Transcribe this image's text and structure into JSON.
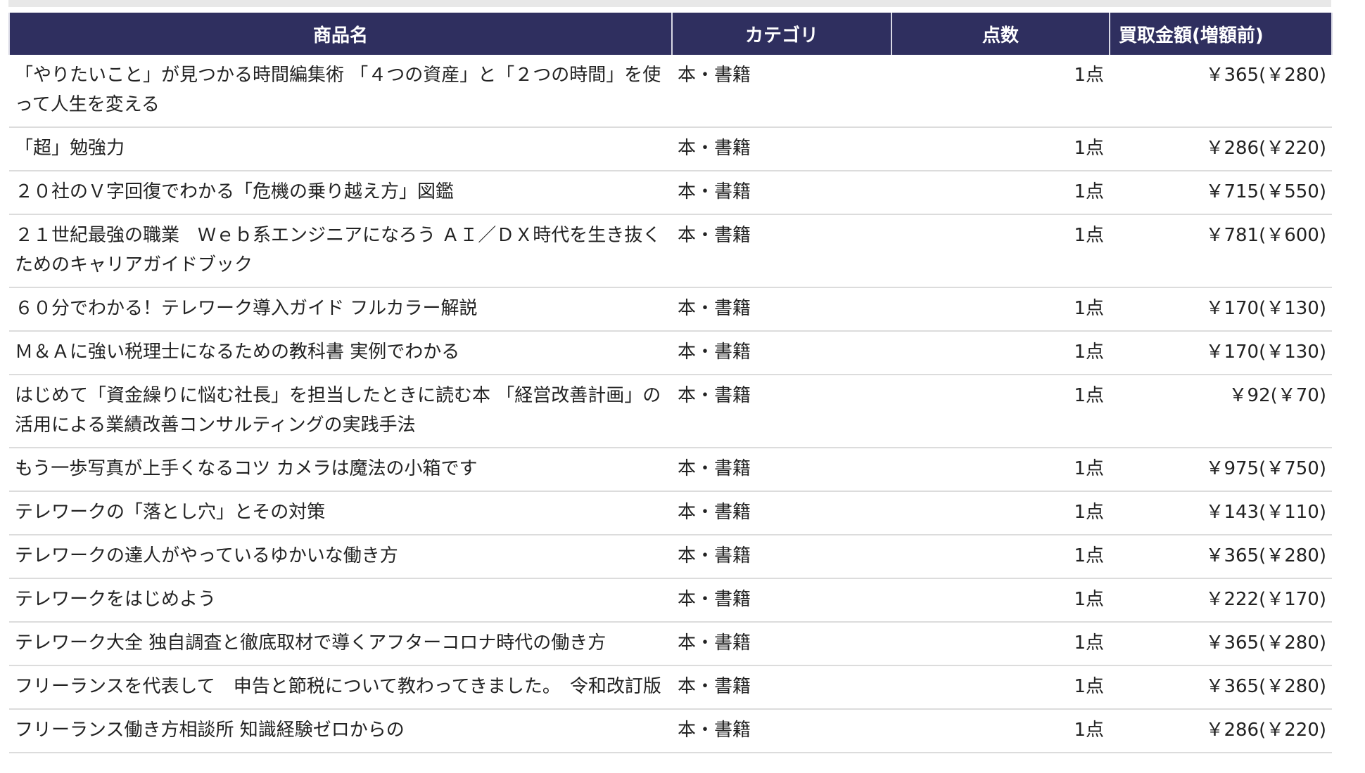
{
  "table": {
    "headers": {
      "name": "商品名",
      "category": "カテゴリ",
      "count": "点数",
      "amount": "買取金額(増額前)"
    },
    "rows": [
      {
        "name": "「やりたいこと」が見つかる時間編集術 「４つの資産」と「２つの時間」を使って人生を変える",
        "category": "本・書籍",
        "count": "1点",
        "amount": "￥365(￥280)"
      },
      {
        "name": "「超」勉強力",
        "category": "本・書籍",
        "count": "1点",
        "amount": "￥286(￥220)"
      },
      {
        "name": "２０社のＶ字回復でわかる「危機の乗り越え方」図鑑",
        "category": "本・書籍",
        "count": "1点",
        "amount": "￥715(￥550)"
      },
      {
        "name": "２１世紀最強の職業　Ｗｅｂ系エンジニアになろう ＡＩ／ＤＸ時代を生き抜くためのキャリアガイドブック",
        "category": "本・書籍",
        "count": "1点",
        "amount": "￥781(￥600)"
      },
      {
        "name": "６０分でわかる！テレワーク導入ガイド フルカラー解説",
        "category": "本・書籍",
        "count": "1点",
        "amount": "￥170(￥130)"
      },
      {
        "name": "Ｍ＆Ａに強い税理士になるための教科書 実例でわかる",
        "category": "本・書籍",
        "count": "1点",
        "amount": "￥170(￥130)"
      },
      {
        "name": "はじめて「資金繰りに悩む社長」を担当したときに読む本 「経営改善計画」の活用による業績改善コンサルティングの実践手法",
        "category": "本・書籍",
        "count": "1点",
        "amount": "￥92(￥70)"
      },
      {
        "name": "もう一歩写真が上手くなるコツ カメラは魔法の小箱です",
        "category": "本・書籍",
        "count": "1点",
        "amount": "￥975(￥750)"
      },
      {
        "name": "テレワークの「落とし穴」とその対策",
        "category": "本・書籍",
        "count": "1点",
        "amount": "￥143(￥110)"
      },
      {
        "name": "テレワークの達人がやっているゆかいな働き方",
        "category": "本・書籍",
        "count": "1点",
        "amount": "￥365(￥280)"
      },
      {
        "name": "テレワークをはじめよう",
        "category": "本・書籍",
        "count": "1点",
        "amount": "￥222(￥170)"
      },
      {
        "name": "テレワーク大全 独自調査と徹底取材で導くアフターコロナ時代の働き方",
        "category": "本・書籍",
        "count": "1点",
        "amount": "￥365(￥280)"
      },
      {
        "name": "フリーランスを代表して　申告と節税について教わってきました。　令和改訂版",
        "category": "本・書籍",
        "count": "1点",
        "amount": "￥365(￥280)"
      },
      {
        "name": "フリーランス働き方相談所 知識経験ゼロからの",
        "category": "本・書籍",
        "count": "1点",
        "amount": "￥286(￥220)"
      }
    ]
  },
  "colors": {
    "header_bg": "#2f2f5f",
    "header_text": "#ffffff",
    "row_divider": "#dcdcdc"
  }
}
